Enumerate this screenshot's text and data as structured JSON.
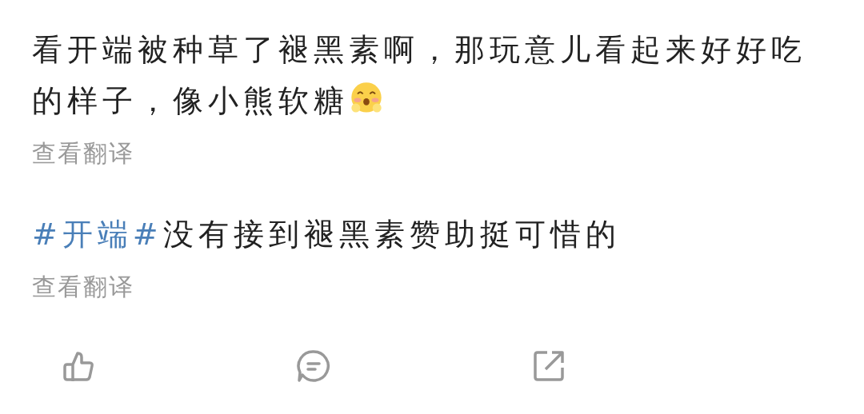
{
  "posts": [
    {
      "text": "看开端被种草了褪黑素啊，那玩意儿看起来好好吃的样子，像小熊软糖",
      "kind": "emoji",
      "translate": "查看翻译"
    },
    {
      "kind": "hashtag",
      "hashtag": "#开端#",
      "text": "没有接到褪黑素赞助挺可惜的",
      "translate": "查看翻译"
    }
  ],
  "actions": [
    {
      "kind": "like"
    },
    {
      "kind": "comment"
    },
    {
      "kind": "share"
    }
  ]
}
